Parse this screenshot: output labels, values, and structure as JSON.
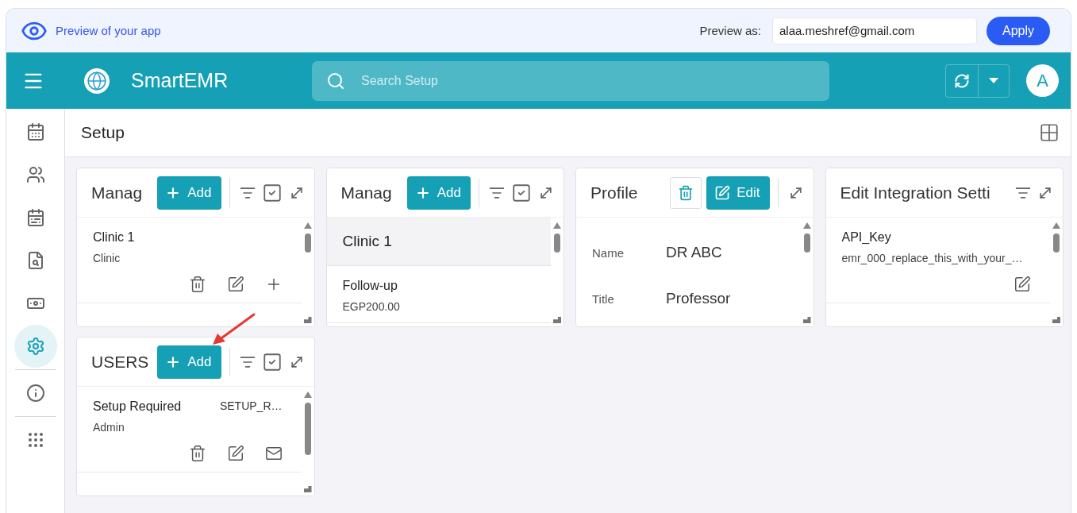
{
  "preview_bar": {
    "label": "Preview of your app",
    "preview_as_label": "Preview as:",
    "email": "alaa.meshref@gmail.com",
    "apply": "Apply"
  },
  "header": {
    "app_name": "SmartEMR",
    "search_placeholder": "Search Setup",
    "avatar": "A"
  },
  "sidebar": {
    "groups": [
      [
        {
          "kind": "calendar",
          "selected": false
        },
        {
          "kind": "users",
          "selected": false
        },
        {
          "kind": "schedule",
          "selected": false
        },
        {
          "kind": "search",
          "selected": false
        },
        {
          "kind": "billing",
          "selected": false
        },
        {
          "kind": "settings",
          "selected": true
        }
      ],
      [
        {
          "kind": "info",
          "selected": false
        }
      ],
      [
        {
          "kind": "apps",
          "selected": false
        }
      ]
    ]
  },
  "page": {
    "title": "Setup"
  },
  "cards": [
    {
      "title": "Manag",
      "controls": [
        {
          "kind": "add",
          "label": "Add"
        },
        {
          "kind": "divider"
        },
        {
          "kind": "filter"
        },
        {
          "kind": "select"
        },
        {
          "kind": "expand"
        }
      ],
      "rows": [
        {
          "kind": "item",
          "title": "Clinic 1",
          "subtitle": "Clinic",
          "actions": [
            {
              "kind": "delete"
            },
            {
              "kind": "edit"
            },
            {
              "kind": "add"
            }
          ]
        }
      ]
    },
    {
      "title": "Manag",
      "controls": [
        {
          "kind": "add",
          "label": "Add"
        },
        {
          "kind": "divider"
        },
        {
          "kind": "filter"
        },
        {
          "kind": "select"
        },
        {
          "kind": "expand"
        }
      ],
      "rows": [
        {
          "kind": "group",
          "title": "Clinic 1"
        },
        {
          "kind": "item",
          "title": "Follow-up",
          "subtitle": "EGP200.00"
        }
      ]
    },
    {
      "title": "Profile",
      "controls": [
        {
          "kind": "delete"
        },
        {
          "kind": "edit",
          "label": "Edit"
        },
        {
          "kind": "divider"
        },
        {
          "kind": "expand"
        }
      ],
      "rows": [
        {
          "kind": "field",
          "label": "Name",
          "value": "DR ABC"
        },
        {
          "kind": "field",
          "label": "Title",
          "value": "Professor"
        }
      ]
    },
    {
      "title": "Edit Integration Setti",
      "controls": [
        {
          "kind": "filter"
        },
        {
          "kind": "expand"
        }
      ],
      "rows": [
        {
          "kind": "item",
          "title": "API_Key",
          "subtitle": "emr_000_replace_this_with_your_…",
          "actions": [
            {
              "kind": "edit"
            }
          ]
        }
      ]
    },
    {
      "title": "USERS",
      "controls": [
        {
          "kind": "add",
          "label": "Add"
        },
        {
          "kind": "divider"
        },
        {
          "kind": "filter"
        },
        {
          "kind": "select"
        },
        {
          "kind": "expand"
        }
      ],
      "rows": [
        {
          "kind": "item",
          "title": "Setup Required",
          "code": "SETUP_R…",
          "subtitle": "Admin",
          "actions": [
            {
              "kind": "delete"
            },
            {
              "kind": "edit"
            },
            {
              "kind": "mail"
            }
          ]
        }
      ]
    }
  ]
}
